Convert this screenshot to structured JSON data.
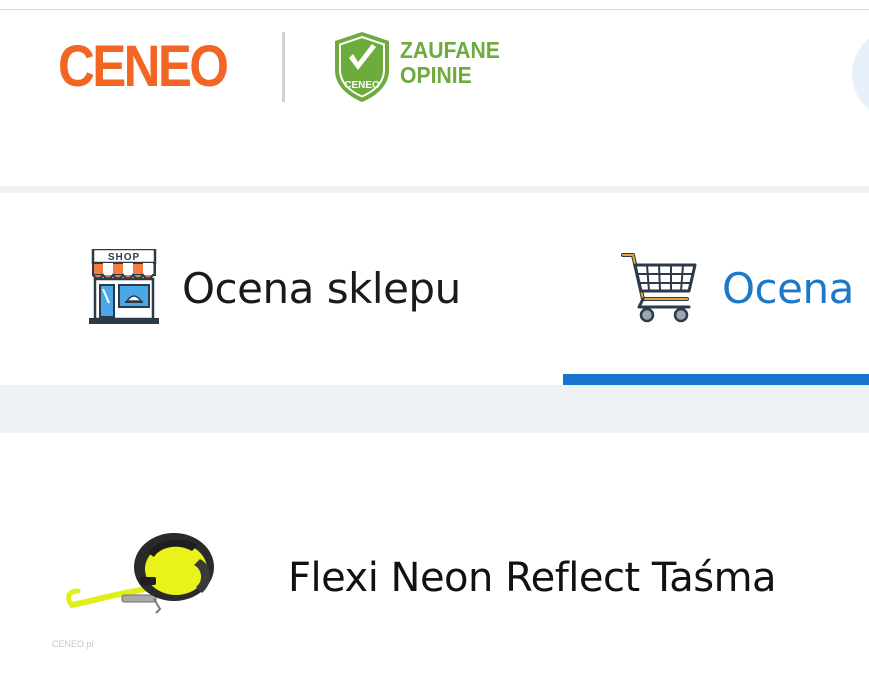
{
  "header": {
    "logo_text": "CENEO",
    "badge": {
      "shield_text": "CENEO",
      "line1": "ZAUFANE",
      "line2": "OPINIE"
    },
    "avatar_icon": "user-avatar-icon"
  },
  "tabs": [
    {
      "label": "Ocena sklepu",
      "icon": "shop-icon",
      "active": false
    },
    {
      "label": "Ocena",
      "icon": "shopping-cart-icon",
      "active": true
    }
  ],
  "product": {
    "name": "Flexi Neon Reflect Taśma",
    "thumbnail_watermark": "CENEO.pl",
    "image_icon": "retractable-leash-icon"
  },
  "colors": {
    "brand_orange": "#f26522",
    "badge_green": "#6dab3c",
    "active_tab_blue": "#1e78c8",
    "tab_underline": "#1774d1"
  }
}
